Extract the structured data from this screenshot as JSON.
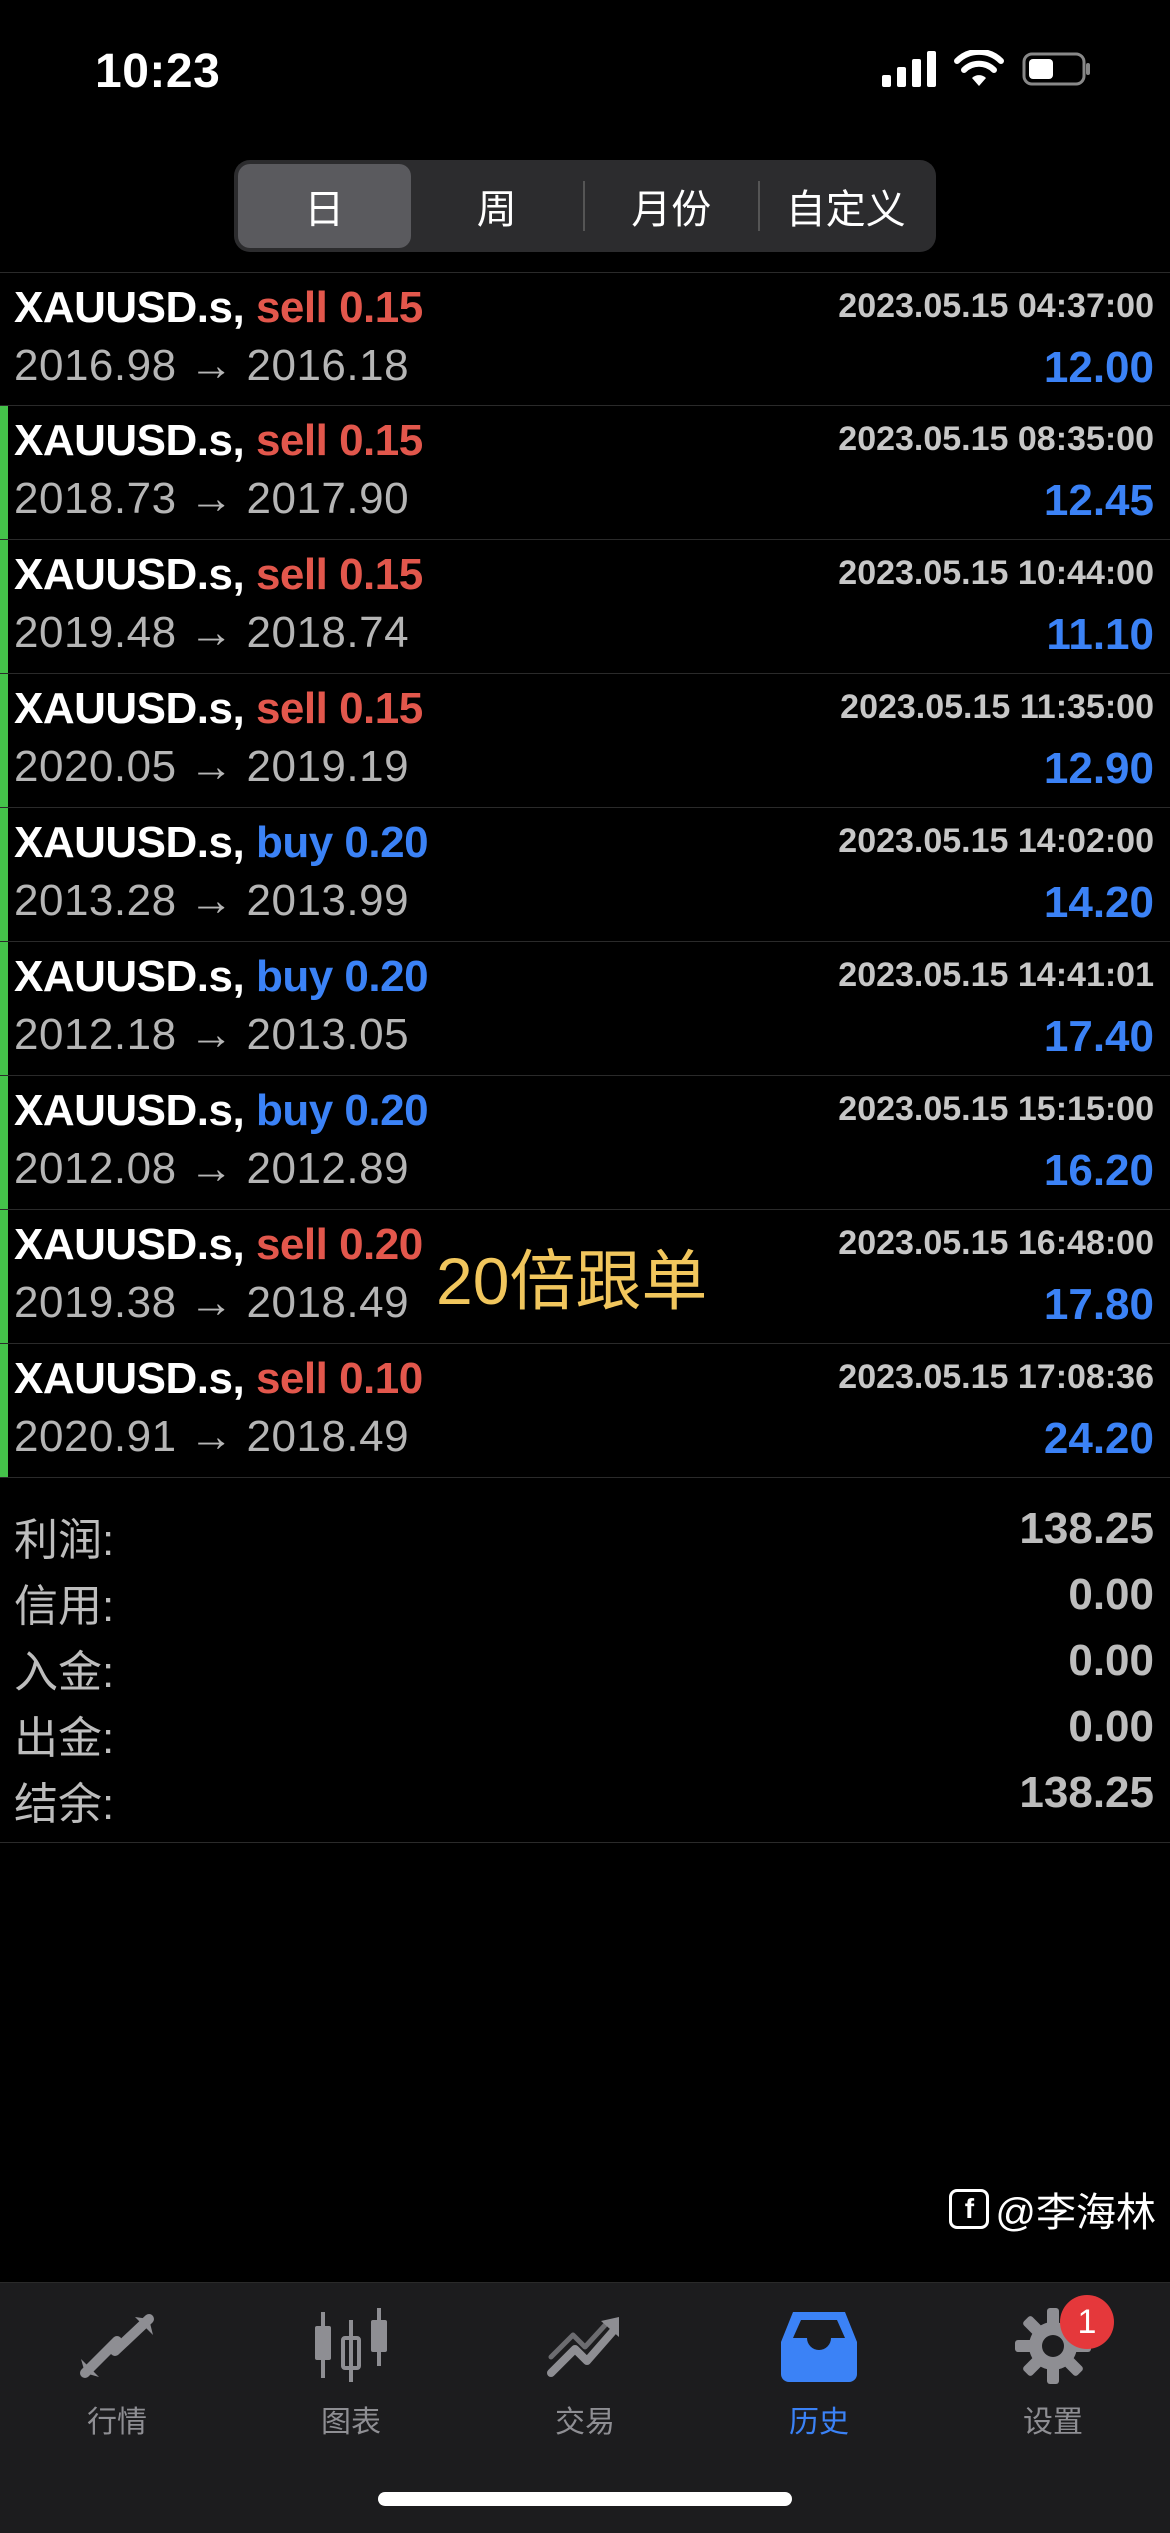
{
  "status": {
    "time": "10:23"
  },
  "segments": [
    {
      "label": "日",
      "active": true
    },
    {
      "label": "周",
      "active": false
    },
    {
      "label": "月份",
      "active": false
    },
    {
      "label": "自定义",
      "active": false
    }
  ],
  "trades": [
    {
      "symbol": "XAUUSD.s,",
      "side": "sell",
      "side_label": "sell 0.15",
      "time": "2023.05.15 04:37:00",
      "prices": "2016.98 → 2016.18",
      "profit": "12.00",
      "marked": false
    },
    {
      "symbol": "XAUUSD.s,",
      "side": "sell",
      "side_label": "sell 0.15",
      "time": "2023.05.15 08:35:00",
      "prices": "2018.73 → 2017.90",
      "profit": "12.45",
      "marked": true
    },
    {
      "symbol": "XAUUSD.s,",
      "side": "sell",
      "side_label": "sell 0.15",
      "time": "2023.05.15 10:44:00",
      "prices": "2019.48 → 2018.74",
      "profit": "11.10",
      "marked": true
    },
    {
      "symbol": "XAUUSD.s,",
      "side": "sell",
      "side_label": "sell 0.15",
      "time": "2023.05.15 11:35:00",
      "prices": "2020.05 → 2019.19",
      "profit": "12.90",
      "marked": true
    },
    {
      "symbol": "XAUUSD.s,",
      "side": "buy",
      "side_label": "buy 0.20",
      "time": "2023.05.15 14:02:00",
      "prices": "2013.28 → 2013.99",
      "profit": "14.20",
      "marked": true
    },
    {
      "symbol": "XAUUSD.s,",
      "side": "buy",
      "side_label": "buy 0.20",
      "time": "2023.05.15 14:41:01",
      "prices": "2012.18 → 2013.05",
      "profit": "17.40",
      "marked": true
    },
    {
      "symbol": "XAUUSD.s,",
      "side": "buy",
      "side_label": "buy 0.20",
      "time": "2023.05.15 15:15:00",
      "prices": "2012.08 → 2012.89",
      "profit": "16.20",
      "marked": true
    },
    {
      "symbol": "XAUUSD.s,",
      "side": "sell",
      "side_label": "sell 0.20",
      "time": "2023.05.15 16:48:00",
      "prices": "2019.38 → 2018.49",
      "profit": "17.80",
      "marked": true
    },
    {
      "symbol": "XAUUSD.s,",
      "side": "sell",
      "side_label": "sell 0.10",
      "time": "2023.05.15 17:08:36",
      "prices": "2020.91 → 2018.49",
      "profit": "24.20",
      "marked": true
    }
  ],
  "overlay_note": "20倍跟单",
  "summary": [
    {
      "label": "利润:",
      "value": "138.25"
    },
    {
      "label": "信用:",
      "value": "0.00"
    },
    {
      "label": "入金:",
      "value": "0.00"
    },
    {
      "label": "出金:",
      "value": "0.00"
    },
    {
      "label": "结余:",
      "value": "138.25"
    }
  ],
  "tabs": [
    {
      "label": "行情",
      "icon": "quotes-arrows-icon",
      "active": false
    },
    {
      "label": "图表",
      "icon": "candlestick-chart-icon",
      "active": false
    },
    {
      "label": "交易",
      "icon": "trade-trend-icon",
      "active": false
    },
    {
      "label": "历史",
      "icon": "history-inbox-icon",
      "active": true
    },
    {
      "label": "设置",
      "icon": "gear-icon",
      "active": false,
      "badge": "1"
    }
  ],
  "watermark": "@李海林",
  "colors": {
    "sell": "#e2574c",
    "buy": "#3b82f6",
    "active": "#3b82f6",
    "marker": "#44c24a",
    "note": "#f1c65d"
  }
}
